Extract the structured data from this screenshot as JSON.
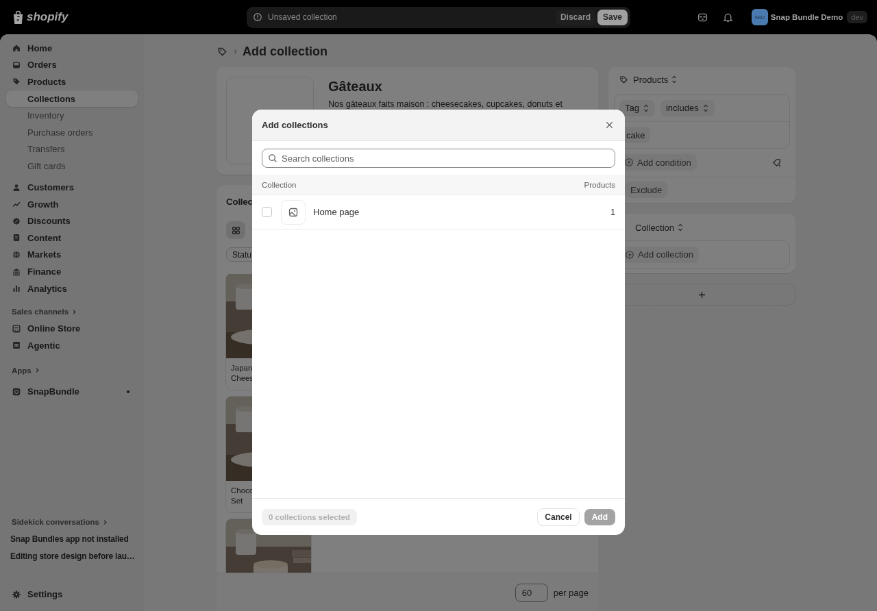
{
  "top_bar": {
    "logo": "shopify",
    "save_bar": {
      "message": "Unsaved collection",
      "discard": "Discard",
      "save": "Save"
    },
    "store": {
      "initials": "SBD",
      "name": "Snap Bundle Demo",
      "badge": "dev"
    }
  },
  "sidebar": {
    "nav": [
      {
        "label": "Home",
        "selected": false
      },
      {
        "label": "Orders",
        "selected": false
      },
      {
        "label": "Products",
        "selected": false,
        "children": [
          {
            "label": "Collections",
            "selected": true
          },
          {
            "label": "Inventory",
            "selected": false
          },
          {
            "label": "Purchase orders",
            "selected": false
          },
          {
            "label": "Transfers",
            "selected": false
          },
          {
            "label": "Gift cards",
            "selected": false
          }
        ]
      },
      {
        "label": "Customers",
        "selected": false
      },
      {
        "label": "Growth",
        "selected": false
      },
      {
        "label": "Discounts",
        "selected": false
      },
      {
        "label": "Content",
        "selected": false
      },
      {
        "label": "Markets",
        "selected": false
      },
      {
        "label": "Finance",
        "selected": false
      },
      {
        "label": "Analytics",
        "selected": false
      }
    ],
    "sales_channels": {
      "heading": "Sales channels",
      "items": [
        {
          "label": "Online Store",
          "selected": false
        },
        {
          "label": "Agentic",
          "selected": false
        }
      ]
    },
    "apps": {
      "heading": "Apps",
      "items": [
        {
          "label": "SnapBundle",
          "selected": false
        }
      ]
    },
    "sidekick": {
      "heading": "Sidekick conversations",
      "items": [
        "Snap Bundles app not installed",
        "Editing store design before lau…"
      ]
    },
    "settings": "Settings"
  },
  "page": {
    "title": "Add collection",
    "collection_card": {
      "title": "Gâteaux",
      "description": "Nos gâteaux faits maison : cheesecakes, cupcakes, donuts et"
    },
    "products_card": {
      "heading": "Collec",
      "filter": "Statu",
      "products": [
        {
          "kind": "picture",
          "label_lines": [
            "Japan",
            "Chees"
          ]
        },
        {
          "kind": "picture",
          "label_lines": [
            "Choco",
            "Set"
          ]
        },
        {
          "kind": "picture"
        }
      ],
      "per_page": "60",
      "per_page_label": "per page"
    },
    "rules_card": {
      "heading": "Products",
      "field": "Tag",
      "operator": "includes",
      "value": "cake",
      "add_condition": "Add condition",
      "exclude": "Exclude"
    },
    "collection_rules_card": {
      "heading": "Collection",
      "add_button": "Add collection"
    }
  },
  "modal": {
    "title": "Add collections",
    "search_placeholder": "Search collections",
    "columns": [
      "Collection",
      "Products"
    ],
    "rows": [
      {
        "name": "Home page",
        "count": "1",
        "selected": false
      }
    ],
    "selected_count": "0 collections selected",
    "cancel": "Cancel",
    "add": "Add"
  }
}
